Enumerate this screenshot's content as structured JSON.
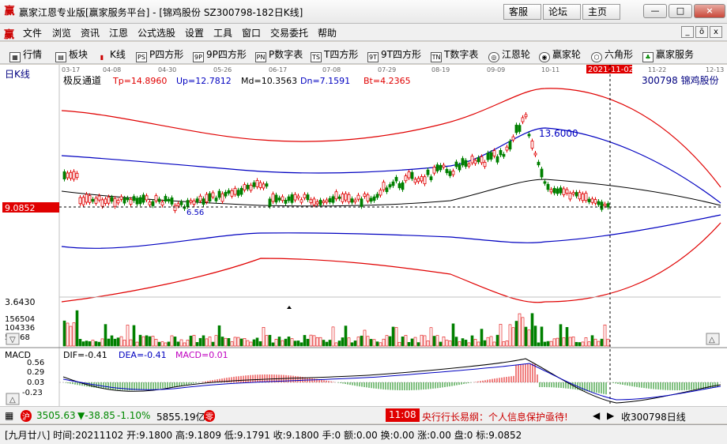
{
  "window": {
    "title": "赢家江恩专业版[赢家服务平台] - [锦鸡股份  SZ300798-182日K线]",
    "links": [
      "客服",
      "论坛",
      "主页"
    ],
    "min": "—",
    "max": "□",
    "close": "×"
  },
  "menu": [
    "文件",
    "浏览",
    "资讯",
    "江恩",
    "公式选股",
    "设置",
    "工具",
    "窗口",
    "交易委托",
    "帮助"
  ],
  "mdi_buttons": [
    "_",
    "ō",
    "x"
  ],
  "toolbar": [
    {
      "label": "行情",
      "icon": "grid-icon"
    },
    {
      "label": "板块",
      "icon": "sector-icon"
    },
    {
      "label": "K线",
      "icon": "candlestick-icon"
    },
    {
      "label": "P四方形",
      "icon": "ps-icon",
      "glyph": "PS"
    },
    {
      "label": "9P四方形",
      "icon": "9p-icon",
      "glyph": "9P"
    },
    {
      "label": "P数字表",
      "icon": "pn-icon",
      "glyph": "PN"
    },
    {
      "label": "T四方形",
      "icon": "ts-icon",
      "glyph": "TS"
    },
    {
      "label": "9T四方形",
      "icon": "9t-icon",
      "glyph": "9T"
    },
    {
      "label": "T数字表",
      "icon": "tn-icon",
      "glyph": "TN"
    },
    {
      "label": "江恩轮",
      "icon": "gann-wheel-icon"
    },
    {
      "label": "赢家轮",
      "icon": "winner-wheel-icon"
    },
    {
      "label": "六角形",
      "icon": "hexagon-icon"
    },
    {
      "label": "赢家服务",
      "icon": "service-icon"
    }
  ],
  "chart": {
    "period_label": "日K线",
    "dates": [
      "03-17",
      "04-08",
      "04-30",
      "05-26",
      "06-17",
      "07-08",
      "07-29",
      "08-19",
      "09-09",
      "10-11",
      "2021-11-02",
      "11-22",
      "12-13"
    ],
    "indicator_name": "极反通道",
    "params": {
      "tp": "Tp=14.8960",
      "up": "Up=12.7812",
      "md": "Md=10.3563",
      "dn": "Dn=7.1591",
      "bt": "Bt=4.2365"
    },
    "stock": "300798  锦鸡股份",
    "current_price": "9.0852",
    "peak_label": "13.6000",
    "low_label": "6.56",
    "vol_labels": [
      "3.6430",
      "156504",
      "104336",
      "52168"
    ],
    "macd": {
      "title": "MACD",
      "dif": "DIF=-0.41",
      "dea": "DEA=-0.41",
      "macd": "MACD=0.01",
      "yticks": [
        "0.56",
        "0.29",
        "0.03",
        "-0.23"
      ]
    },
    "colors": {
      "up": "#e00000",
      "down": "#008000",
      "upper_band": "#e00000",
      "mid_band": "#0000c0",
      "center": "#000000"
    }
  },
  "status": {
    "index_value": "3505.63",
    "index_change": "▼-38.85",
    "index_pct": "-1.10%",
    "turnover": "5855.19亿",
    "time": "11:08",
    "news": "央行行长易纲：个人信息保护亟待!",
    "bookmark": "收300798日线",
    "bar_info": "[九月廿八] 时间:20211102 开:9.1800 高:9.1809 低:9.1791 收:9.1800 手:0 额:0.00 换:0.00 涨:0.00 盘:0 标:9.0852"
  }
}
